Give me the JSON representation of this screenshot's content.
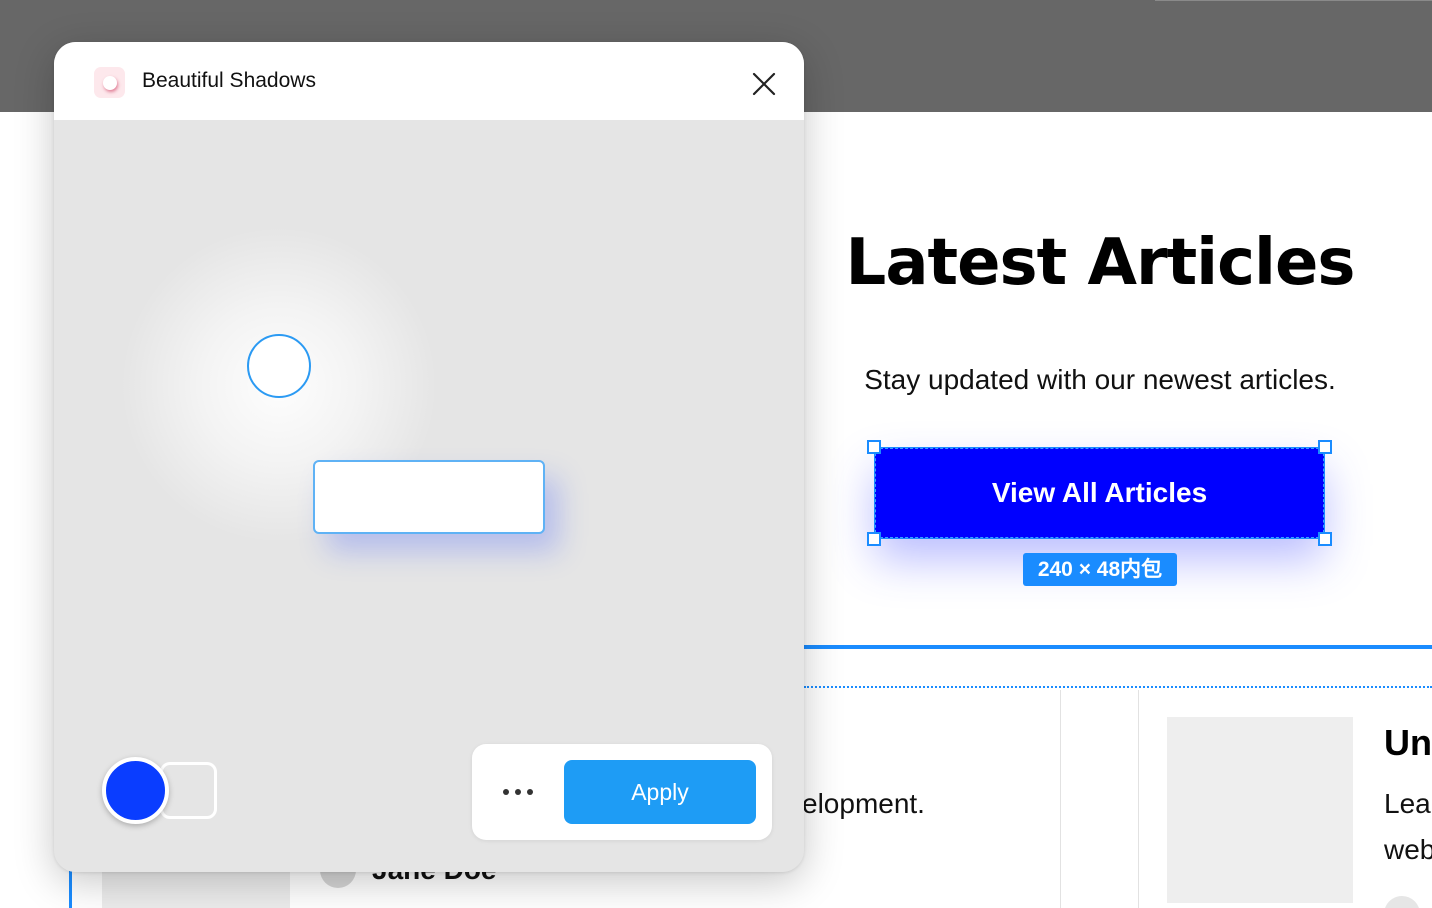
{
  "plugin": {
    "title": "Beautiful Shadows",
    "icon": "shadow-plugin-icon",
    "close_icon": "close-icon",
    "shadow_color": "#0a3dff",
    "background_color": "#e5e5e5",
    "more_label": "more-options-icon",
    "apply_label": "Apply"
  },
  "canvas": {
    "hero": {
      "title": "Latest Articles",
      "subtitle": "Stay updated with our newest articles.",
      "cta_label": "View All Articles",
      "cta_color": "#0000ff"
    },
    "selection": {
      "dimensions_label": "240 × 48内包",
      "accent_color": "#1a8cff"
    },
    "articles": [
      {
        "text_fragment": "elopment.",
        "author_fragment": "Jane Doe"
      },
      {
        "title_fragment": "Unc",
        "line1": "Lea",
        "line2": "web"
      }
    ]
  }
}
